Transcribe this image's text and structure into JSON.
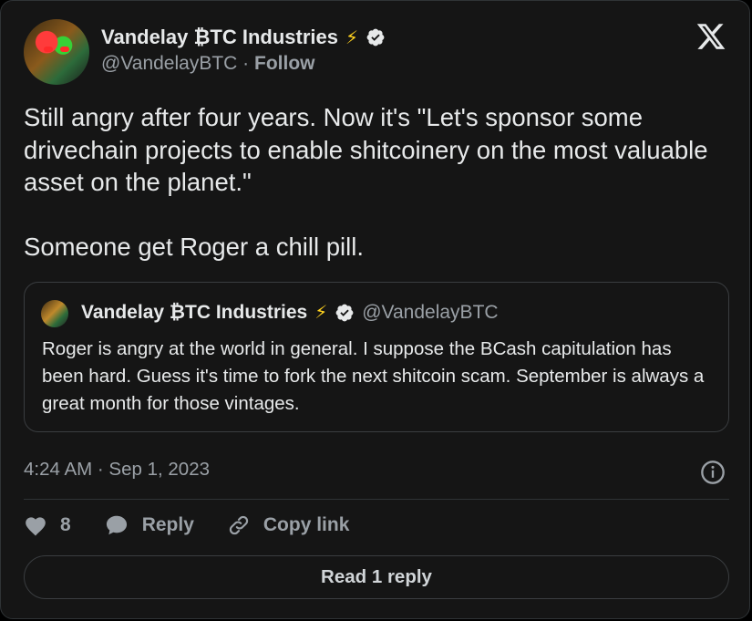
{
  "author": {
    "name": "Vandelay ₿TC Industries",
    "emoji": "⚡",
    "handle": "@VandelayBTC",
    "separator": "·",
    "follow_label": "Follow"
  },
  "tweet": {
    "text": "Still angry after four years. Now it's \"Let's sponsor some drivechain projects to enable shitcoinery on the most valuable asset on the planet.\"\n\nSomeone get Roger a chill pill."
  },
  "quote": {
    "name": "Vandelay ₿TC Industries",
    "emoji": "⚡",
    "handle": "@VandelayBTC",
    "text": "Roger is angry at the world in general. I suppose the BCash capitulation has been hard. Guess it's time to fork the next shitcoin scam. September is always a great month for those vintages."
  },
  "timestamp": "4:24 AM · Sep 1, 2023",
  "actions": {
    "like_count": "8",
    "reply_label": "Reply",
    "copy_link_label": "Copy link"
  },
  "read_reply_label": "Read 1 reply",
  "icons": {
    "logo": "x-logo-icon",
    "verified": "verified-badge-icon",
    "info": "info-icon",
    "like": "heart-icon",
    "reply": "speech-bubble-icon",
    "copy": "link-icon"
  },
  "colors": {
    "background": "#151515",
    "text": "#e7e9ea",
    "secondary": "#9aa0a6",
    "border": "#2f3336",
    "bolt": "#ffd21f"
  }
}
